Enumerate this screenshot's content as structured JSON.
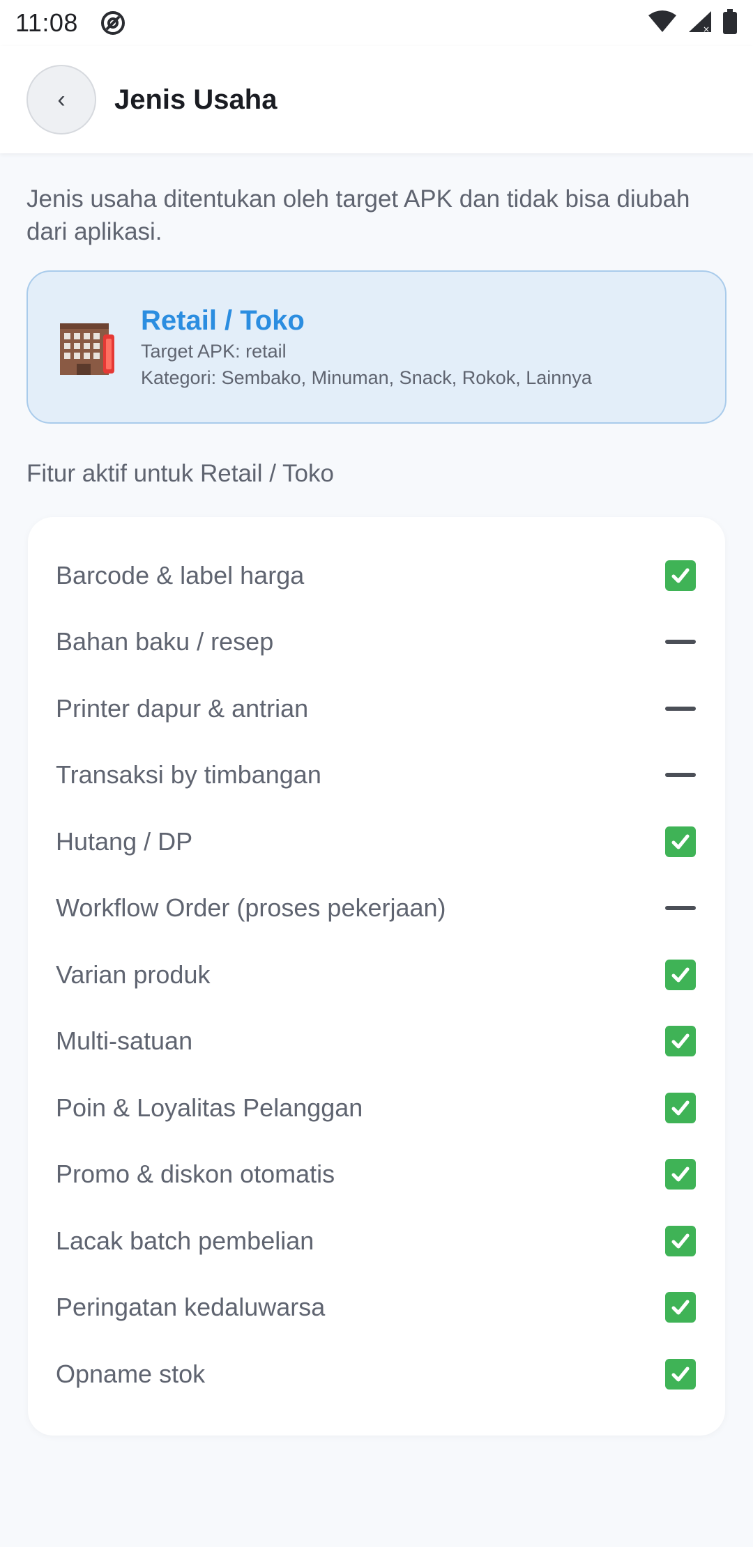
{
  "status_bar": {
    "time": "11:08",
    "icons": [
      "at-sign-icon",
      "wifi-icon",
      "signal-icon",
      "battery-icon"
    ]
  },
  "app_bar": {
    "back_label": "‹",
    "title": "Jenis Usaha"
  },
  "intro_text": "Jenis usaha ditentukan oleh target APK dan tidak bisa diubah dari aplikasi.",
  "business_type": {
    "icon": "building-icon",
    "name": "Retail / Toko",
    "target_apk": "Target APK: retail",
    "categories": "Kategori: Sembako, Minuman, Snack, Rokok, Lainnya"
  },
  "features_title": "Fitur aktif untuk Retail / Toko",
  "features": [
    {
      "label": "Barcode & label harga",
      "active": true
    },
    {
      "label": "Bahan baku / resep",
      "active": false
    },
    {
      "label": "Printer dapur & antrian",
      "active": false
    },
    {
      "label": "Transaksi by timbangan",
      "active": false
    },
    {
      "label": "Hutang / DP",
      "active": true
    },
    {
      "label": "Workflow Order (proses pekerjaan)",
      "active": false
    },
    {
      "label": "Varian produk",
      "active": true
    },
    {
      "label": "Multi-satuan",
      "active": true
    },
    {
      "label": "Poin & Loyalitas Pelanggan",
      "active": true
    },
    {
      "label": "Promo & diskon otomatis",
      "active": true
    },
    {
      "label": "Lacak batch pembelian",
      "active": true
    },
    {
      "label": "Peringatan kedaluwarsa",
      "active": true
    },
    {
      "label": "Opname stok",
      "active": true
    }
  ],
  "colors": {
    "accent": "#2b8de0",
    "card_bg": "#e3eef9",
    "check_green": "#3fb356",
    "background": "#f7f9fc"
  }
}
